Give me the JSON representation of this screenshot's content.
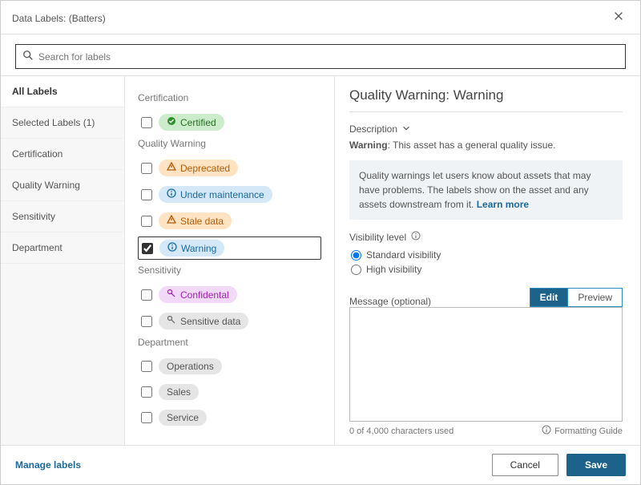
{
  "title": "Data Labels: (Batters)",
  "search": {
    "placeholder": "Search for labels"
  },
  "nav": {
    "items": [
      {
        "label": "All Labels",
        "active": true
      },
      {
        "label": "Selected Labels (1)"
      },
      {
        "label": "Certification"
      },
      {
        "label": "Quality Warning"
      },
      {
        "label": "Sensitivity"
      },
      {
        "label": "Department"
      }
    ]
  },
  "sections": {
    "certification": {
      "title": "Certification",
      "items": [
        {
          "label": "Certified",
          "chip": "chip-certified",
          "icon": "check",
          "checked": false
        }
      ]
    },
    "quality": {
      "title": "Quality Warning",
      "items": [
        {
          "label": "Deprecated",
          "chip": "chip-deprecated",
          "icon": "warn",
          "checked": false
        },
        {
          "label": "Under maintenance",
          "chip": "chip-maint",
          "icon": "info",
          "checked": false
        },
        {
          "label": "Stale data",
          "chip": "chip-stale",
          "icon": "warn",
          "checked": false
        },
        {
          "label": "Warning",
          "chip": "chip-warning",
          "icon": "info",
          "checked": true
        }
      ]
    },
    "sensitivity": {
      "title": "Sensitivity",
      "items": [
        {
          "label": "Confidental",
          "chip": "chip-confidential",
          "icon": "key",
          "checked": false
        },
        {
          "label": "Sensitive data",
          "chip": "chip-sensitive",
          "icon": "key",
          "checked": false
        }
      ]
    },
    "department": {
      "title": "Department",
      "items": [
        {
          "label": "Operations",
          "chip": "chip-gray",
          "icon": "",
          "checked": false
        },
        {
          "label": "Sales",
          "chip": "chip-gray",
          "icon": "",
          "checked": false
        },
        {
          "label": "Service",
          "chip": "chip-gray",
          "icon": "",
          "checked": false
        }
      ]
    }
  },
  "detail": {
    "heading": "Quality Warning: Warning",
    "description_label": "Description",
    "description_name": "Warning",
    "description_text": ": This asset has a general quality issue.",
    "info_box": "Quality warnings let users know about assets that may have problems. The labels show on the asset and any assets downstream from it. ",
    "learn_more": "Learn more",
    "visibility_label": "Visibility level",
    "visibility": {
      "standard": "Standard visibility",
      "high": "High visibility"
    },
    "message_label": "Message (optional)",
    "tabs": {
      "edit": "Edit",
      "preview": "Preview"
    },
    "char_count": "0 of 4,000 characters used",
    "formatting_guide": "Formatting Guide"
  },
  "footer": {
    "manage": "Manage labels",
    "cancel": "Cancel",
    "save": "Save"
  }
}
